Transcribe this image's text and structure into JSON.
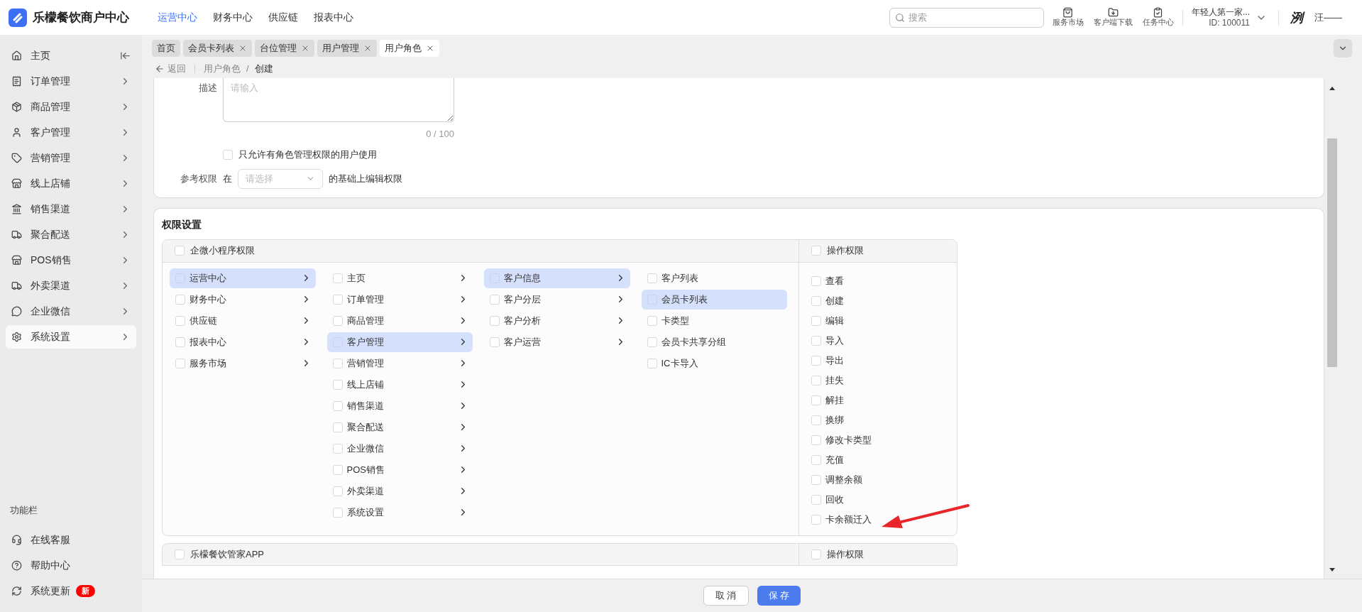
{
  "app": {
    "title": "乐檬餐饮商户中心"
  },
  "top_nav": [
    {
      "label": "运营中心",
      "selected": true
    },
    {
      "label": "财务中心",
      "selected": false
    },
    {
      "label": "供应链",
      "selected": false
    },
    {
      "label": "报表中心",
      "selected": false
    }
  ],
  "search": {
    "placeholder": "搜索"
  },
  "toolbar": [
    {
      "label": "服务市场"
    },
    {
      "label": "客户端下载"
    },
    {
      "label": "任务中心"
    }
  ],
  "account": {
    "name": "年轻人第一家...",
    "id": "ID: 100011"
  },
  "user": {
    "logo_text": "洌",
    "name": "汪——"
  },
  "sidebar": {
    "items": [
      {
        "label": "主页",
        "selected": false
      },
      {
        "label": "订单管理",
        "selected": false
      },
      {
        "label": "商品管理",
        "selected": false
      },
      {
        "label": "客户管理",
        "selected": false
      },
      {
        "label": "营销管理",
        "selected": false
      },
      {
        "label": "线上店铺",
        "selected": false
      },
      {
        "label": "销售渠道",
        "selected": false
      },
      {
        "label": "聚合配送",
        "selected": false
      },
      {
        "label": "POS销售",
        "selected": false
      },
      {
        "label": "外卖渠道",
        "selected": false
      },
      {
        "label": "企业微信",
        "selected": false
      },
      {
        "label": "系统设置",
        "selected": true
      }
    ],
    "section_title": "功能栏",
    "footer_items": [
      {
        "label": "在线客服"
      },
      {
        "label": "帮助中心"
      },
      {
        "label": "系统更新",
        "badge": "新"
      }
    ]
  },
  "tabs": [
    {
      "label": "首页",
      "selected": false,
      "closable": false
    },
    {
      "label": "会员卡列表",
      "selected": false,
      "closable": true
    },
    {
      "label": "台位管理",
      "selected": false,
      "closable": true
    },
    {
      "label": "用户管理",
      "selected": false,
      "closable": true
    },
    {
      "label": "用户角色",
      "selected": true,
      "closable": true
    }
  ],
  "breadcrumb": {
    "back": "返回",
    "separator": "/",
    "items": [
      "用户角色",
      "创建"
    ]
  },
  "form": {
    "description_label": "描述",
    "description_placeholder": "请输入",
    "counter": "0 / 100",
    "restrict": {
      "label": "只允许有角色管理权限的用户使用",
      "checked": false
    },
    "reference": {
      "label": "参考权限",
      "prefix": "在",
      "placeholder": "请选择",
      "suffix": "的基础上编辑权限"
    }
  },
  "permissions": {
    "title": "权限设置",
    "groups": [
      {
        "name": "企微小程序权限",
        "checked": false,
        "ops_title": "操作权限",
        "ops_checked": false,
        "columns": [
          [
            {
              "label": "运营中心",
              "selected": true,
              "checked": false
            },
            {
              "label": "财务中心",
              "selected": false,
              "checked": false
            },
            {
              "label": "供应链",
              "selected": false,
              "checked": false
            },
            {
              "label": "报表中心",
              "selected": false,
              "checked": false
            },
            {
              "label": "服务市场",
              "selected": false,
              "checked": false
            }
          ],
          [
            {
              "label": "主页",
              "selected": false,
              "checked": false
            },
            {
              "label": "订单管理",
              "selected": false,
              "checked": false
            },
            {
              "label": "商品管理",
              "selected": false,
              "checked": false
            },
            {
              "label": "客户管理",
              "selected": true,
              "checked": false
            },
            {
              "label": "营销管理",
              "selected": false,
              "checked": false
            },
            {
              "label": "线上店铺",
              "selected": false,
              "checked": false
            },
            {
              "label": "销售渠道",
              "selected": false,
              "checked": false
            },
            {
              "label": "聚合配送",
              "selected": false,
              "checked": false
            },
            {
              "label": "企业微信",
              "selected": false,
              "checked": false
            },
            {
              "label": "POS销售",
              "selected": false,
              "checked": false
            },
            {
              "label": "外卖渠道",
              "selected": false,
              "checked": false
            },
            {
              "label": "系统设置",
              "selected": false,
              "checked": false
            }
          ],
          [
            {
              "label": "客户信息",
              "selected": true,
              "checked": false
            },
            {
              "label": "客户分层",
              "selected": false,
              "checked": false
            },
            {
              "label": "客户分析",
              "selected": false,
              "checked": false
            },
            {
              "label": "客户运营",
              "selected": false,
              "checked": false
            }
          ],
          [
            {
              "label": "客户列表",
              "selected": false,
              "checked": false,
              "leaf": true
            },
            {
              "label": "会员卡列表",
              "selected": true,
              "checked": false,
              "leaf": true
            },
            {
              "label": "卡类型",
              "selected": false,
              "checked": false,
              "leaf": true
            },
            {
              "label": "会员卡共享分组",
              "selected": false,
              "checked": false,
              "leaf": true
            },
            {
              "label": "IC卡导入",
              "selected": false,
              "checked": false,
              "leaf": true
            }
          ]
        ],
        "operations": [
          {
            "label": "查看",
            "checked": false
          },
          {
            "label": "创建",
            "checked": false
          },
          {
            "label": "编辑",
            "checked": false
          },
          {
            "label": "导入",
            "checked": false
          },
          {
            "label": "导出",
            "checked": false
          },
          {
            "label": "挂失",
            "checked": false
          },
          {
            "label": "解挂",
            "checked": false
          },
          {
            "label": "换绑",
            "checked": false
          },
          {
            "label": "修改卡类型",
            "checked": false
          },
          {
            "label": "充值",
            "checked": false
          },
          {
            "label": "调整余额",
            "checked": false
          },
          {
            "label": "回收",
            "checked": false
          },
          {
            "label": "卡余额迁入",
            "checked": false
          }
        ]
      },
      {
        "name": "乐檬餐饮管家APP",
        "checked": false,
        "ops_title": "操作权限",
        "ops_checked": false
      }
    ]
  },
  "footer": {
    "buttons": [
      {
        "label": "取 消",
        "kind": "secondary"
      },
      {
        "label": "保 存",
        "kind": "primary"
      }
    ]
  }
}
